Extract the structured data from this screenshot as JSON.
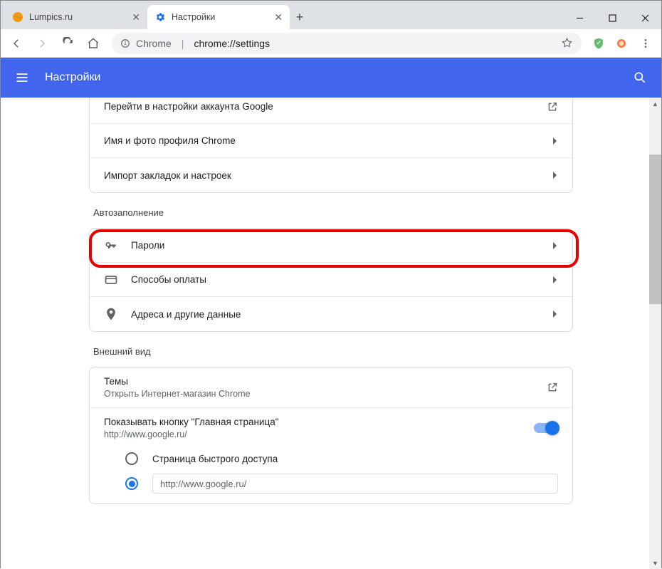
{
  "window": {
    "tabs": [
      {
        "title": "Lumpics.ru"
      },
      {
        "title": "Настройки"
      }
    ]
  },
  "omnibox": {
    "host": "Chrome",
    "path": "chrome://settings"
  },
  "header": {
    "title": "Настройки"
  },
  "sections": {
    "account_card": {
      "google_account": "Перейти в настройки аккаунта Google",
      "profile": "Имя и фото профиля Chrome",
      "import": "Импорт закладок и настроек"
    },
    "autofill": {
      "heading": "Автозаполнение",
      "passwords": "Пароли",
      "payment": "Способы оплаты",
      "addresses": "Адреса и другие данные"
    },
    "appearance": {
      "heading": "Внешний вид",
      "themes_title": "Темы",
      "themes_sub": "Открыть Интернет-магазин Chrome",
      "home_button_title": "Показывать кнопку \"Главная страница\"",
      "home_button_sub": "http://www.google.ru/",
      "radio_ntp": "Страница быстрого доступа",
      "radio_url_value": "http://www.google.ru/"
    }
  }
}
